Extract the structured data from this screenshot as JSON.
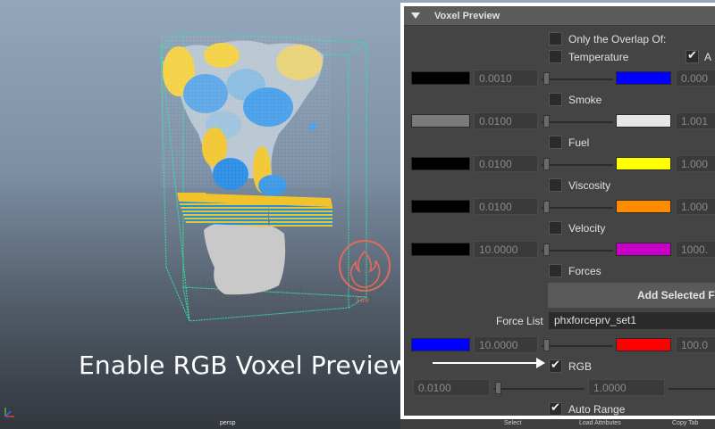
{
  "caption": "Enable RGB Voxel Preview",
  "viewport": {
    "camera_label": "persp",
    "fire_label": "Fire"
  },
  "panel": {
    "title": "Voxel Preview",
    "only_overlap_label": "Only the Overlap Of:",
    "temperature": {
      "label": "Temperature",
      "checked": false,
      "min_color": "#000000",
      "min_value": "0.0010",
      "max_color": "#0000ff",
      "max_value": "0.000",
      "extra_checkbox_label": "A"
    },
    "smoke": {
      "label": "Smoke",
      "checked": false,
      "min_color": "#7a7a7a",
      "min_value": "0.0100",
      "max_color": "#e6e6e6",
      "max_value": "1.001"
    },
    "fuel": {
      "label": "Fuel",
      "checked": false,
      "min_color": "#000000",
      "min_value": "0.0100",
      "max_color": "#ffff00",
      "max_value": "1.000"
    },
    "viscosity": {
      "label": "Viscosity",
      "checked": false,
      "min_color": "#000000",
      "min_value": "0.0100",
      "max_color": "#ff8c00",
      "max_value": "1.000"
    },
    "velocity": {
      "label": "Velocity",
      "checked": false,
      "min_color": "#000000",
      "min_value": "10.0000",
      "max_color": "#c800c8",
      "max_value": "1000."
    },
    "forces": {
      "label": "Forces",
      "checked": false
    },
    "add_selected_label": "Add Selected F",
    "force_list_label": "Force List",
    "force_list_value": "phxforceprv_set1",
    "force_row": {
      "min_color": "#0000ff",
      "min_value": "10.0000",
      "max_color": "#ff0000",
      "max_value": "100.0"
    },
    "rgb": {
      "label": "RGB",
      "checked": true,
      "min_value": "0.0100",
      "max_value": "1.0000"
    },
    "auto_range": {
      "label": "Auto Range",
      "checked": true
    }
  },
  "bottom_bar": {
    "select": "Select",
    "load_attributes": "Load Attributes",
    "copy_tab": "Copy Tab"
  }
}
